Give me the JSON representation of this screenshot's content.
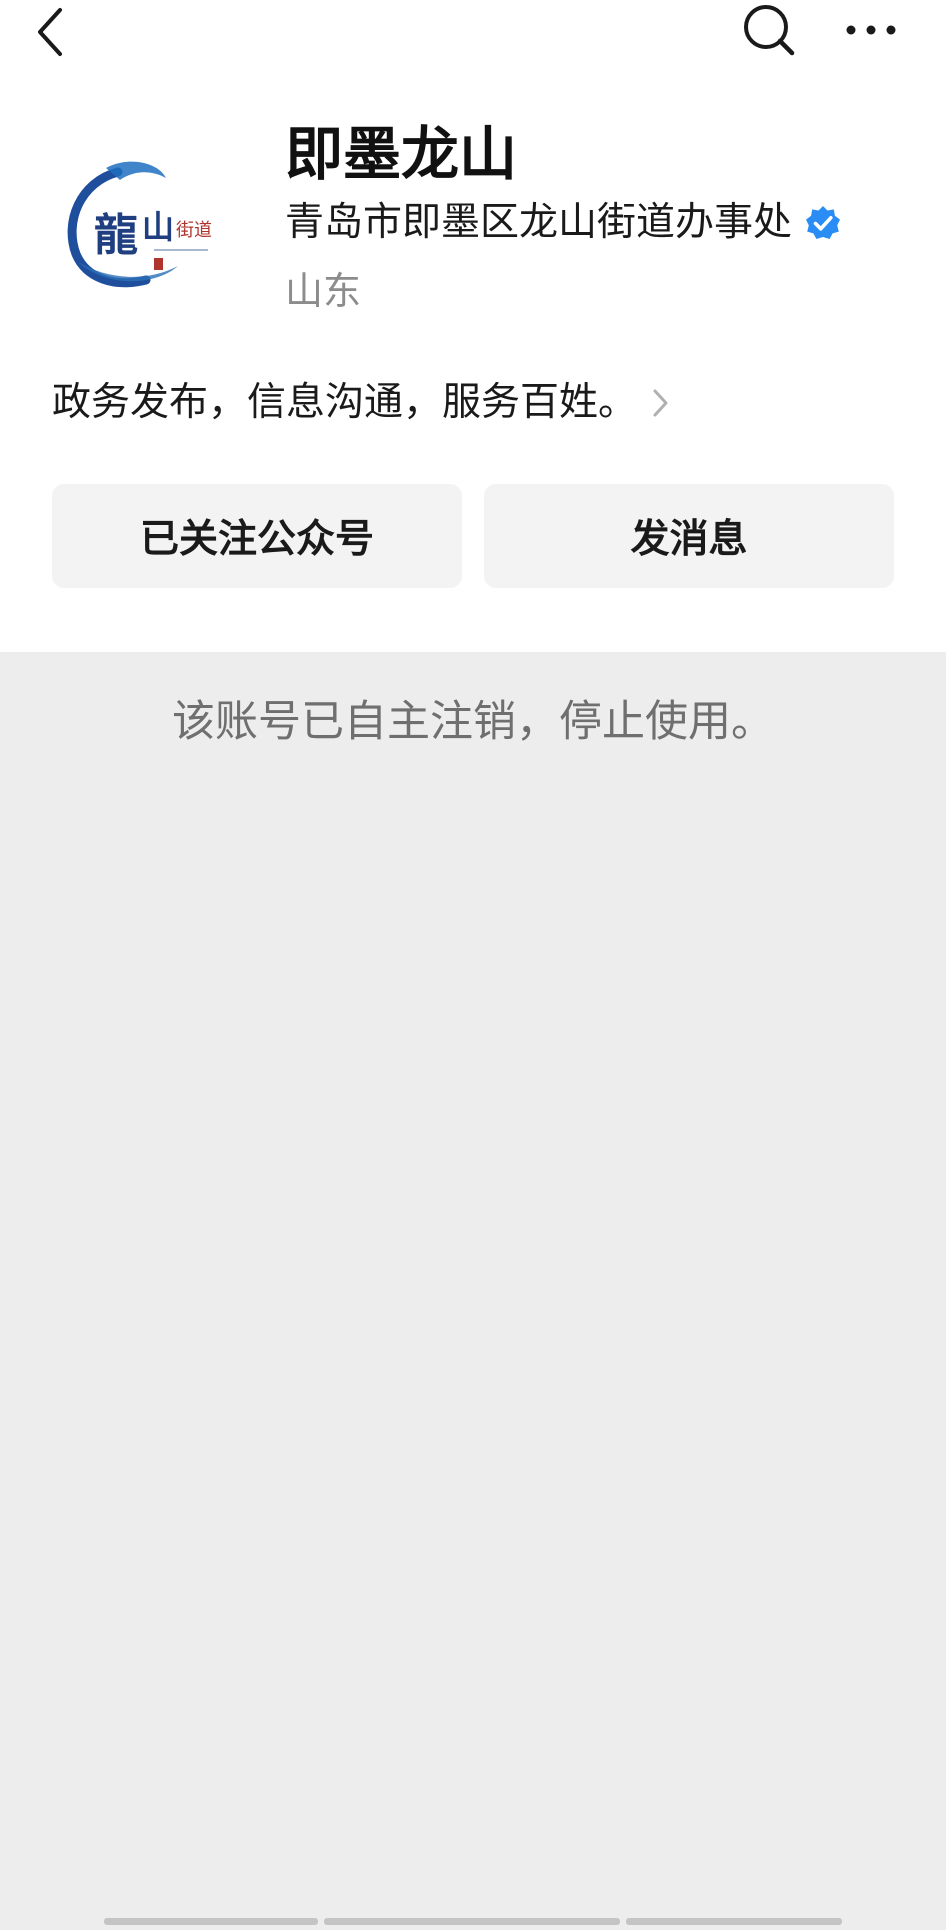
{
  "header": {
    "back_icon": "chevron-left-icon",
    "search_icon": "search-icon",
    "more_icon": "more-horizontal-icon"
  },
  "profile": {
    "avatar_icon": "longshan-logo",
    "avatar_text": "龍山街道",
    "title": "即墨龙山",
    "org_name": "青岛市即墨区龙山街道办事处",
    "verified_icon": "verified-badge-icon",
    "verified_color": "#2a8df5",
    "location": "山东",
    "description": "政务发布，信息沟通，服务百姓。"
  },
  "actions": {
    "follow_label": "已关注公众号",
    "message_label": "发消息"
  },
  "content": {
    "notice": "该账号已自主注销，停止使用。"
  },
  "colors": {
    "background": "#ededed",
    "card": "#ffffff",
    "button_bg": "#f3f3f3",
    "logo_blue": "#1f4f9c",
    "logo_red": "#b0342e"
  }
}
